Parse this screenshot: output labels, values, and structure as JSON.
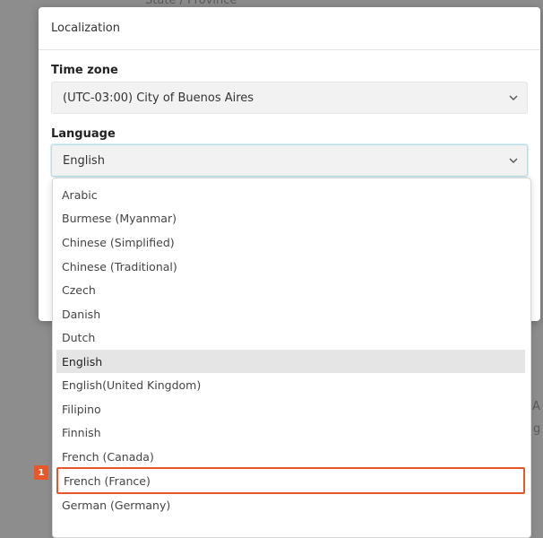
{
  "background": {
    "top_text": "State / Province",
    "right_frag_1": "A",
    "right_frag_2": "g"
  },
  "modal": {
    "title": "Localization",
    "timezone": {
      "label": "Time zone",
      "value": "(UTC-03:00) City of Buenos Aires"
    },
    "language": {
      "label": "Language",
      "value": "English"
    }
  },
  "dropdown": {
    "options": [
      "Arabic",
      "Burmese (Myanmar)",
      "Chinese (Simplified)",
      "Chinese (Traditional)",
      "Czech",
      "Danish",
      "Dutch",
      "English",
      "English(United Kingdom)",
      "Filipino",
      "Finnish",
      "French (Canada)",
      "French (France)",
      "German (Germany)"
    ],
    "selected": "English",
    "highlighted": "French (France)"
  },
  "annotation": {
    "marker_label": "1",
    "color": "#e8572a"
  }
}
